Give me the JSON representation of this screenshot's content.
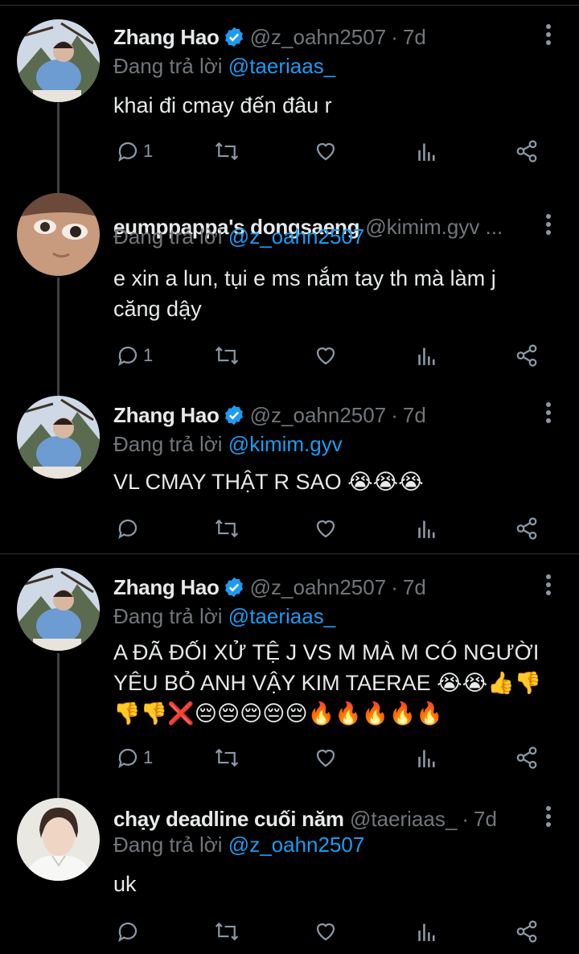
{
  "colors": {
    "background": "#000000",
    "text": "#e7e9ea",
    "muted": "#71767b",
    "accent": "#1d9bf0",
    "icon": "#8b98a5",
    "thread_line": "#3e4144"
  },
  "tweets": [
    {
      "name": "Zhang Hao",
      "verified": true,
      "handle": "@z_oahn2507",
      "separator": "·",
      "time": "7d",
      "reply_prefix": "Đang trả lời",
      "reply_to": "@taeriaas_",
      "lines": [
        "khai đi cmay đến đâu r"
      ],
      "reply_count": "1",
      "avatar": "avatar-zhang-hao"
    },
    {
      "name": "eumppappa's dongsaeng",
      "verified": false,
      "handle": "@kimim.gyv ...",
      "separator": "",
      "time": "",
      "reply_prefix": "Đang trả lời",
      "reply_to": "@z_oahn2507",
      "lines": [
        "e xin a lun, tụi e ms nắm tay th mà làm j",
        "căng dậy"
      ],
      "reply_count": "1",
      "avatar": "avatar-kimim"
    },
    {
      "name": "Zhang Hao",
      "verified": true,
      "handle": "@z_oahn2507",
      "separator": "·",
      "time": "7d",
      "reply_prefix": "Đang trả lời",
      "reply_to": "@kimim.gyv",
      "lines": [
        "VL CMAY THẬT R SAO 😭😭😭"
      ],
      "reply_count": "",
      "avatar": "avatar-zhang-hao"
    },
    {
      "name": "Zhang Hao",
      "verified": true,
      "handle": "@z_oahn2507",
      "separator": "·",
      "time": "7d",
      "reply_prefix": "Đang trả lời",
      "reply_to": "@taeriaas_",
      "lines": [
        "A ĐÃ ĐỐI XỬ TỆ J VS M MÀ M CÓ NGƯỜI",
        "YÊU BỎ ANH VẬY KIM TAERAE 😭😭👍👎",
        "👎👎❌😔😔😔😔😔🔥🔥🔥🔥🔥"
      ],
      "reply_count": "1",
      "avatar": "avatar-zhang-hao"
    },
    {
      "name": "chạy deadline cuối năm",
      "verified": false,
      "handle": "@taeriaas_",
      "separator": "·",
      "time": "7d",
      "reply_prefix": "Đang trả lời",
      "reply_to": "@z_oahn2507",
      "lines": [
        "uk"
      ],
      "reply_count": "",
      "avatar": "avatar-taeriaas"
    }
  ]
}
